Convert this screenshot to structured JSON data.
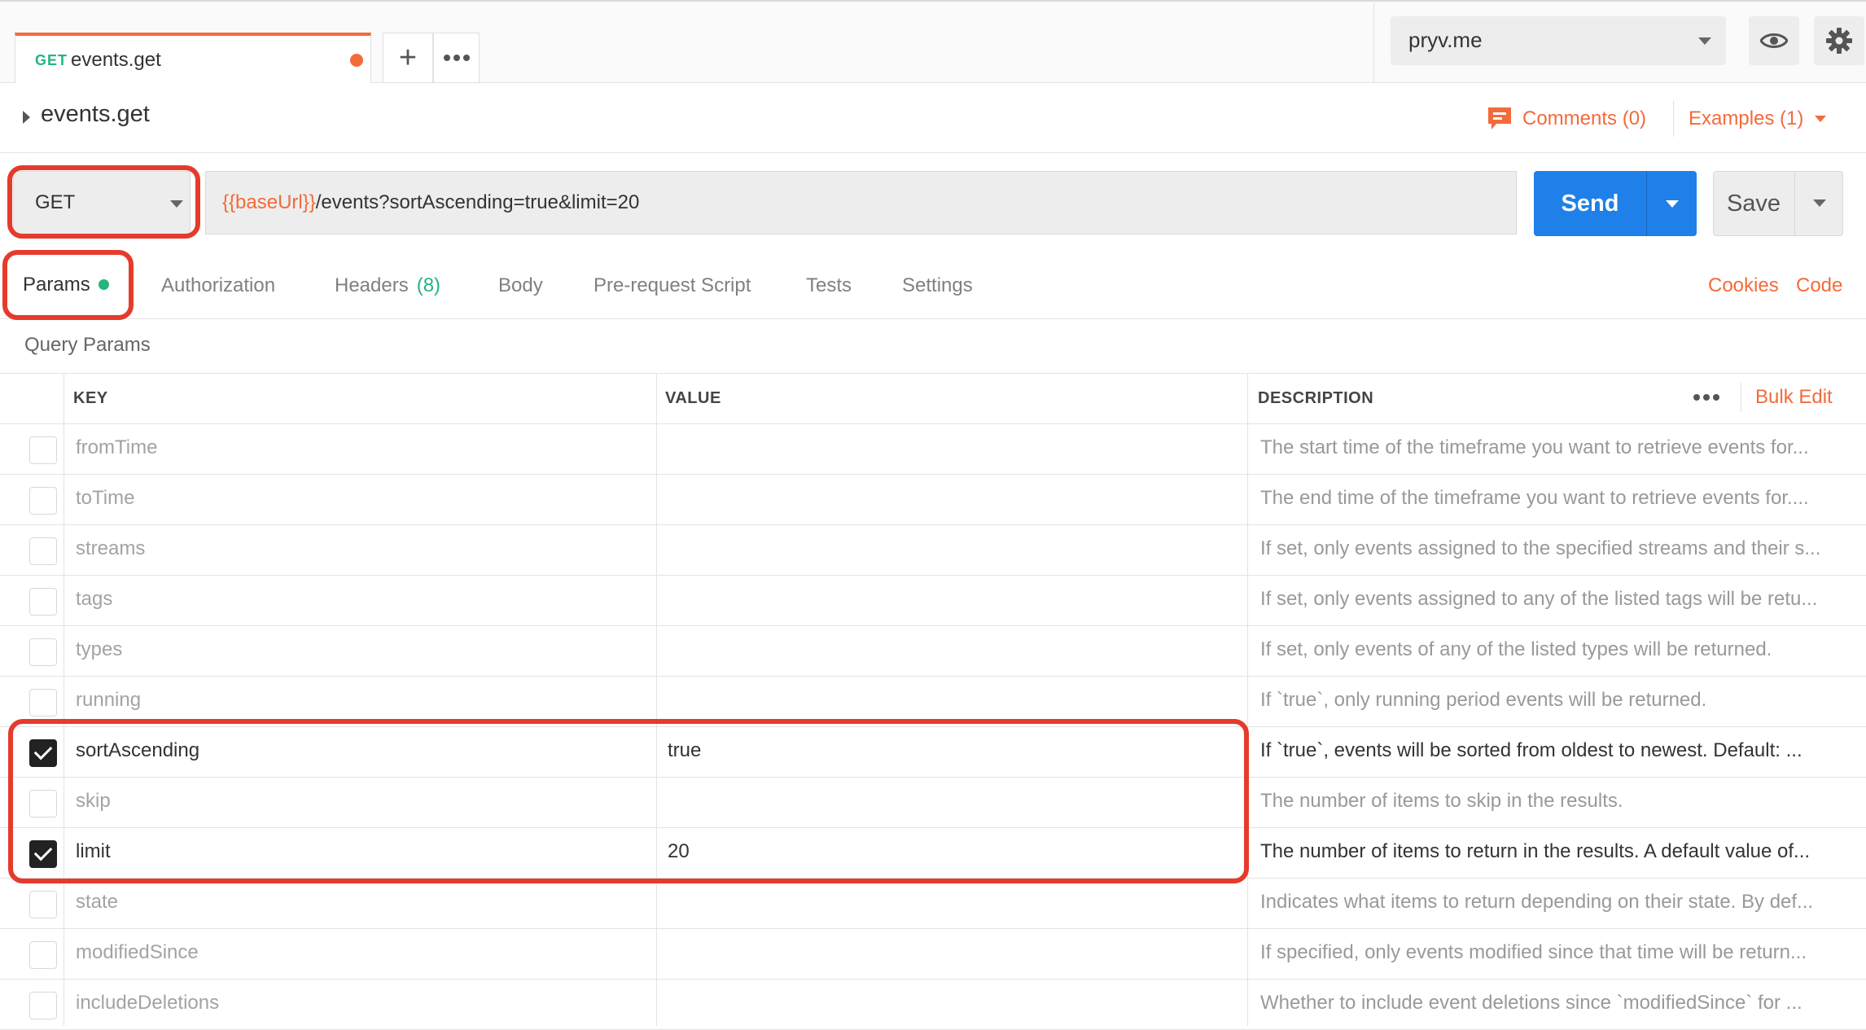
{
  "tab": {
    "method": "GET",
    "name": "events.get"
  },
  "environment": {
    "selected": "pryv.me"
  },
  "request": {
    "name": "events.get",
    "comments_label": "Comments (0)",
    "examples_label": "Examples (1)",
    "method": "GET",
    "url_variable": "{{baseUrl}}",
    "url_path": "/events?sortAscending=true&limit=20",
    "send_label": "Send",
    "save_label": "Save"
  },
  "subtabs": {
    "params": "Params",
    "authorization": "Authorization",
    "headers": "Headers",
    "headers_count": "(8)",
    "body": "Body",
    "prerequest": "Pre-request Script",
    "tests": "Tests",
    "settings": "Settings",
    "cookies": "Cookies",
    "code": "Code"
  },
  "query_params": {
    "title": "Query Params",
    "columns": {
      "key": "KEY",
      "value": "VALUE",
      "description": "DESCRIPTION"
    },
    "bulk_edit": "Bulk Edit",
    "rows": [
      {
        "checked": false,
        "key": "fromTime",
        "value": "",
        "description": "The start time of the timeframe you want to retrieve events for..."
      },
      {
        "checked": false,
        "key": "toTime",
        "value": "",
        "description": "The end time of the timeframe you want to retrieve events for...."
      },
      {
        "checked": false,
        "key": "streams",
        "value": "",
        "description": "If set, only events assigned to the specified streams and their s..."
      },
      {
        "checked": false,
        "key": "tags",
        "value": "",
        "description": "If set, only events assigned to any of the listed tags will be retu..."
      },
      {
        "checked": false,
        "key": "types",
        "value": "",
        "description": "If set, only events of any of the listed types will be returned."
      },
      {
        "checked": false,
        "key": "running",
        "value": "",
        "description": "If `true`, only running period events will be returned."
      },
      {
        "checked": true,
        "key": "sortAscending",
        "value": "true",
        "description": "If `true`, events will be sorted from oldest to newest. Default: ..."
      },
      {
        "checked": false,
        "key": "skip",
        "value": "",
        "description": "The number of items to skip in the results."
      },
      {
        "checked": true,
        "key": "limit",
        "value": "20",
        "description": "The number of items to return in the results. A default value of..."
      },
      {
        "checked": false,
        "key": "state",
        "value": "",
        "description": "Indicates what items to return depending on their state. By def..."
      },
      {
        "checked": false,
        "key": "modifiedSince",
        "value": "",
        "description": "If specified, only events modified since that time will be return..."
      },
      {
        "checked": false,
        "key": "includeDeletions",
        "value": "",
        "description": "Whether to include event deletions since `modifiedSince` for ..."
      }
    ]
  }
}
